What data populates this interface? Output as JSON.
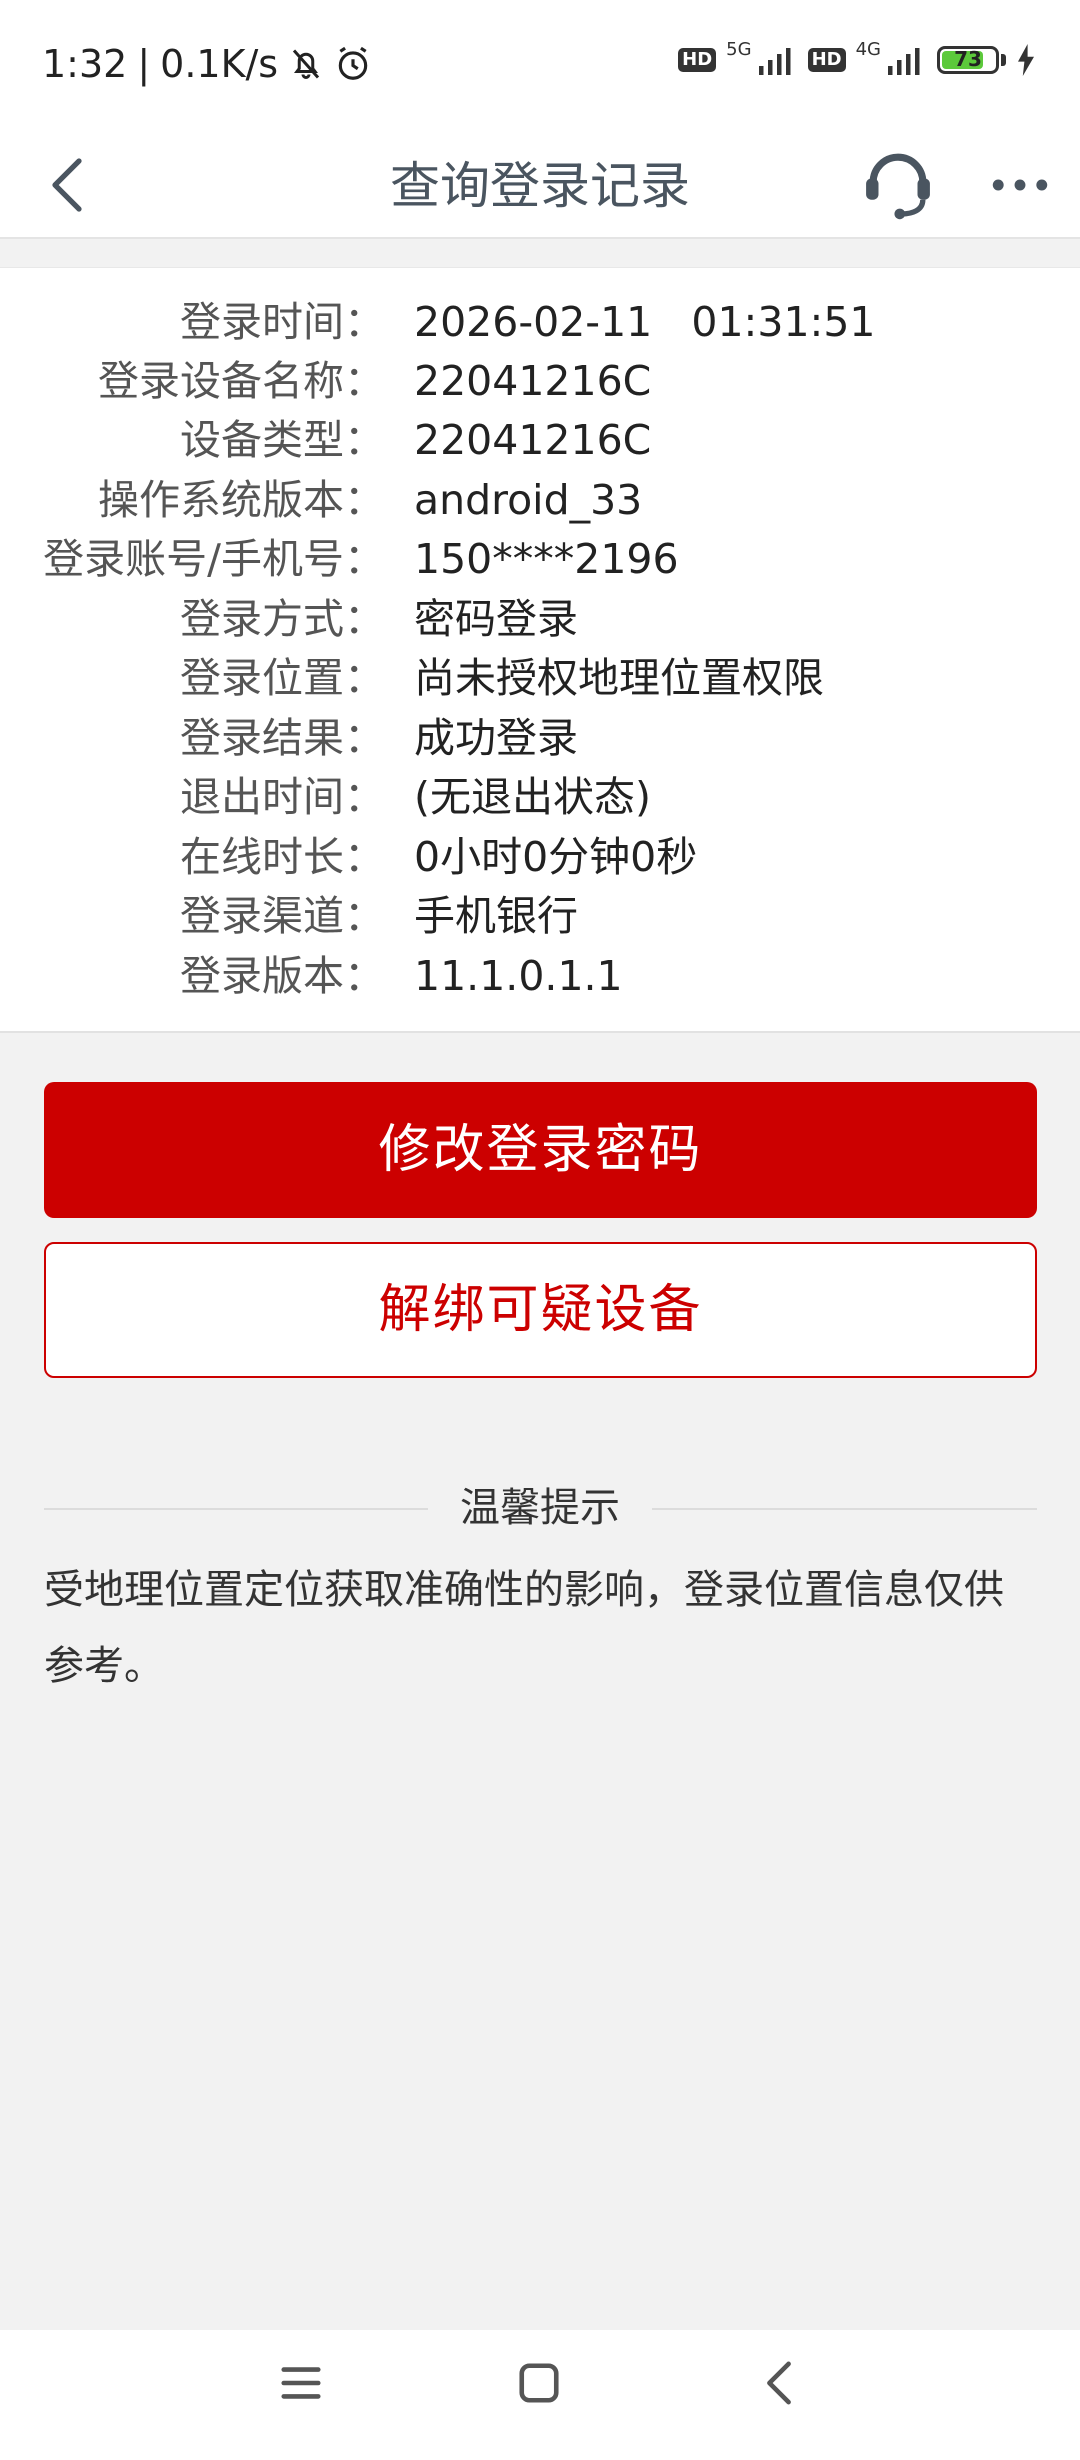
{
  "status_bar": {
    "time": "1:32",
    "separator": "|",
    "net_speed": "0.1K/s",
    "sim1_hd": "HD",
    "sim1_net": "5G",
    "sim2_hd": "HD",
    "sim2_net": "4G",
    "battery": "73",
    "icons": [
      "bell-muted-icon",
      "alarm-icon",
      "signal-icon",
      "battery-icon",
      "charging-icon"
    ]
  },
  "header": {
    "title": "查询登录记录",
    "icons": [
      "back-arrow-icon",
      "customer-service-icon",
      "more-icon"
    ]
  },
  "login_record": {
    "rows": [
      {
        "label": "登录时间：",
        "value": "2026-02-11   01:31:51"
      },
      {
        "label": "登录设备名称：",
        "value": "22041216C"
      },
      {
        "label": "设备类型：",
        "value": "22041216C"
      },
      {
        "label": "操作系统版本：",
        "value": "android_33"
      },
      {
        "label": "登录账号/手机号：",
        "value": "150****2196"
      },
      {
        "label": "登录方式：",
        "value": "密码登录"
      },
      {
        "label": "登录位置：",
        "value": "尚未授权地理位置权限"
      },
      {
        "label": "登录结果：",
        "value": "成功登录"
      },
      {
        "label": "退出时间：",
        "value": "(无退出状态)"
      },
      {
        "label": "在线时长：",
        "value": "0小时0分钟0秒"
      },
      {
        "label": "登录渠道：",
        "value": "手机银行"
      },
      {
        "label": "登录版本：",
        "value": "11.1.0.1.1"
      }
    ]
  },
  "actions": {
    "change_password": "修改登录密码",
    "unbind_device": "解绑可疑设备"
  },
  "tips": {
    "title": "温馨提示",
    "text": "受地理位置定位获取准确性的影响，登录位置信息仅供参考。"
  },
  "system_nav": {
    "icons": [
      "menu-icon",
      "home-icon",
      "back-icon"
    ]
  },
  "colors": {
    "accent": "#cc0000",
    "page_background": "#f2f2f2",
    "title_text": "#4a5560"
  }
}
